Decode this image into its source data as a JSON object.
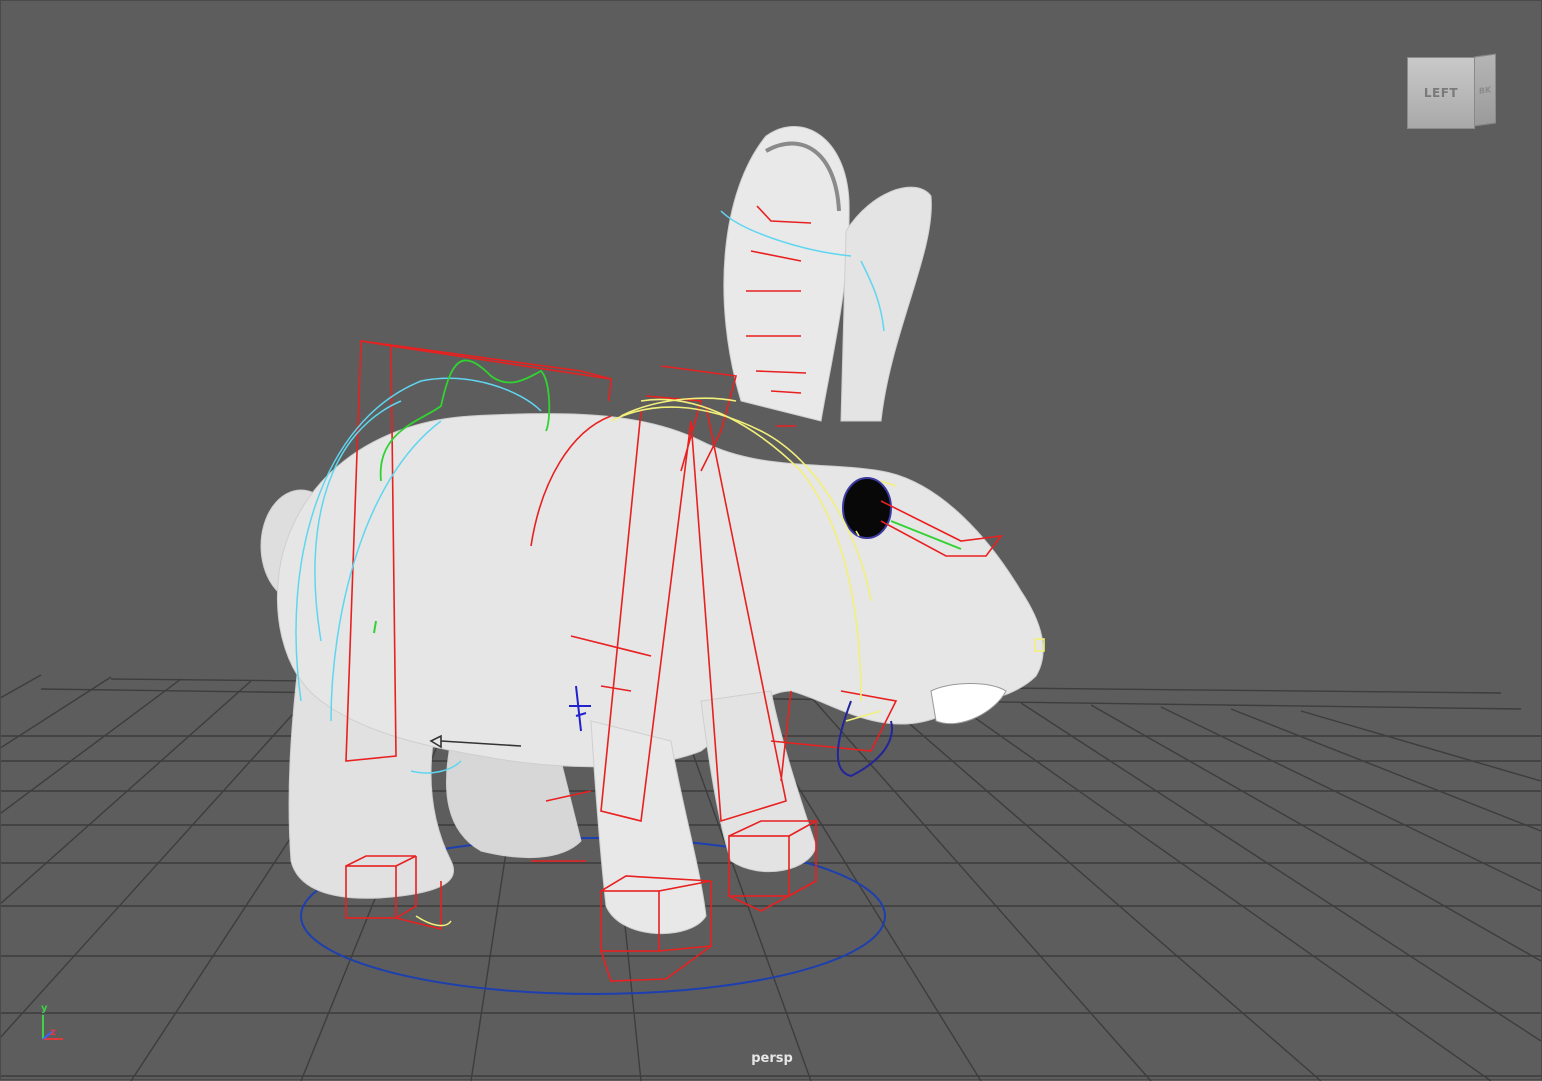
{
  "viewport": {
    "camera_label": "persp",
    "background_color": "#5d5d5d",
    "grid_color": "#3c3c3c"
  },
  "view_cube": {
    "front_label": "LEFT",
    "side_label": "BK"
  },
  "axis_gizmo": {
    "y_label": "y",
    "z_label": "z",
    "x_color": "#e03b3b",
    "y_color": "#3fd14a",
    "z_color": "#3a63ff"
  },
  "scene": {
    "model": "rabbit",
    "rig_control_colors": {
      "fk_boxes": "#e82020",
      "spline_curves": "#5fd6f0",
      "spine_curve": "#31d331",
      "head_curves": "#f2f07a",
      "root_circle": "#1d3fb0"
    }
  }
}
